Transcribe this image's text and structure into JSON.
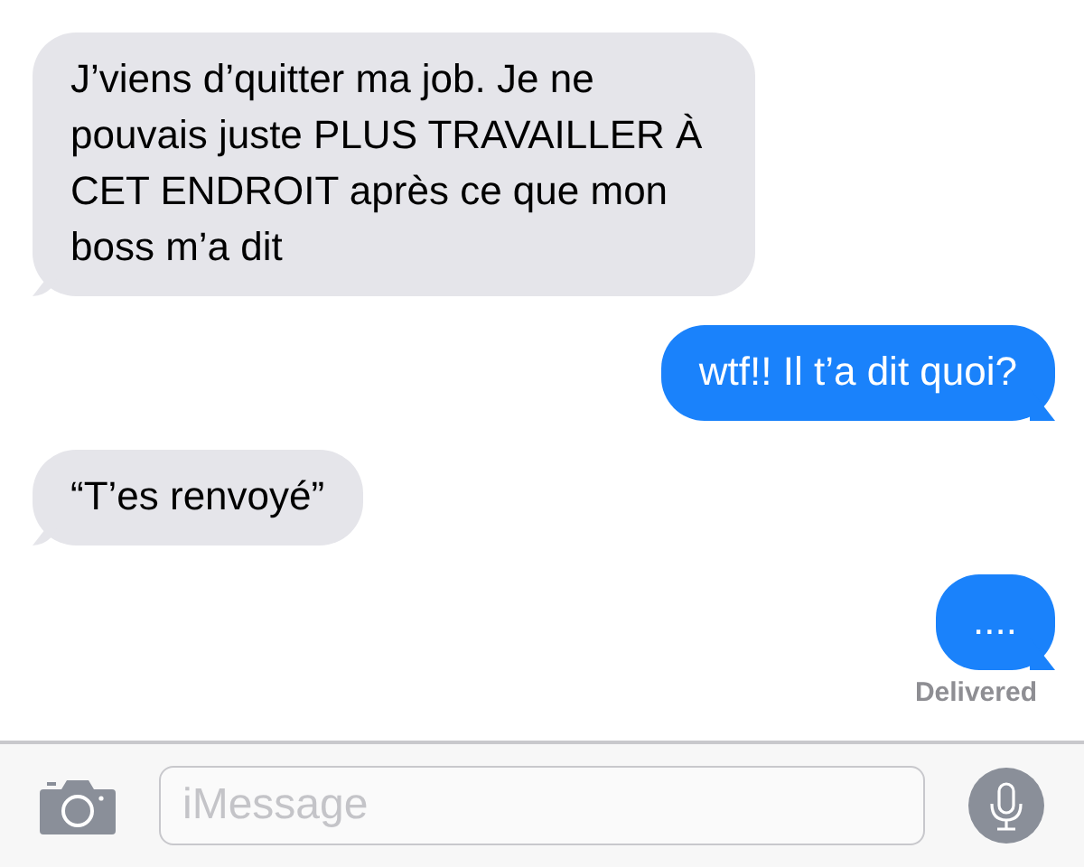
{
  "messages": [
    {
      "kind": "received",
      "text": "J’viens d’quitter ma job. Je ne pouvais juste PLUS TRAVAILLER À CET ENDROIT après ce que mon boss m’a dit"
    },
    {
      "kind": "sent",
      "text": "wtf!! Il t’a dit quoi?"
    },
    {
      "kind": "received",
      "text": "“T’es renvoyé”"
    },
    {
      "kind": "sent",
      "text": "...."
    }
  ],
  "status": "Delivered",
  "composer": {
    "placeholder": "iMessage"
  }
}
